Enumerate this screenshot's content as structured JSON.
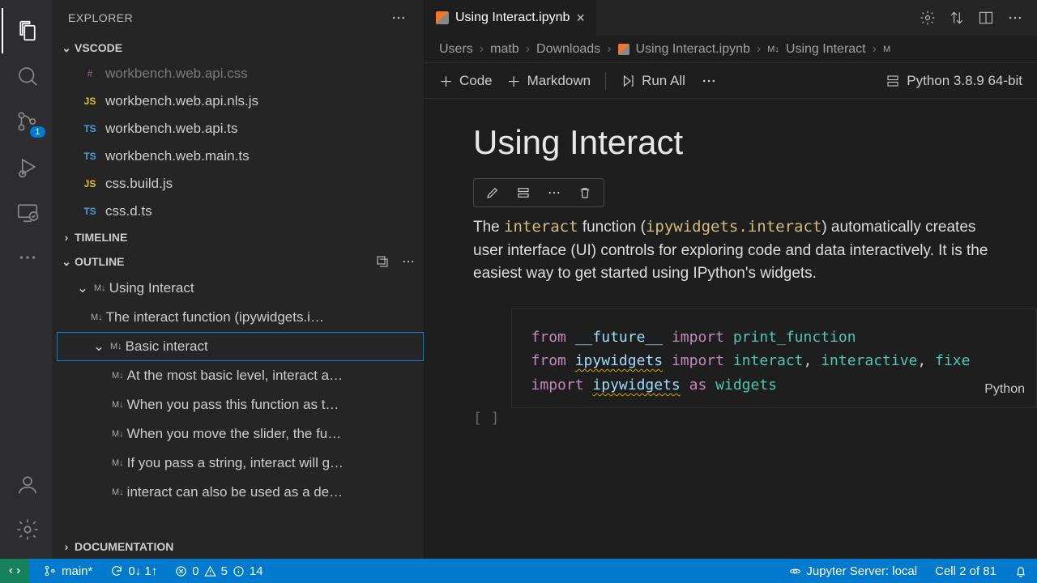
{
  "sidebar": {
    "title": "EXPLORER",
    "sections": {
      "vscode": "VSCODE",
      "timeline": "TIMELINE",
      "outline": "OUTLINE",
      "documentation": "DOCUMENTATION"
    },
    "files": [
      {
        "icon": "#",
        "lang": "hash",
        "name": "workbench.web.api.css"
      },
      {
        "icon": "JS",
        "lang": "js",
        "name": "workbench.web.api.nls.js"
      },
      {
        "icon": "TS",
        "lang": "ts",
        "name": "workbench.web.api.ts"
      },
      {
        "icon": "TS",
        "lang": "ts",
        "name": "workbench.web.main.ts"
      },
      {
        "icon": "JS",
        "lang": "js",
        "name": "css.build.js"
      },
      {
        "icon": "TS",
        "lang": "ts",
        "name": "css.d.ts"
      }
    ],
    "outline": [
      {
        "level": 1,
        "chev": true,
        "label": "Using Interact"
      },
      {
        "level": 2,
        "chev": false,
        "label": "The interact function (ipywidgets.i…"
      },
      {
        "level": 2,
        "chev": true,
        "label": "Basic interact",
        "selected": true
      },
      {
        "level": 3,
        "chev": false,
        "label": "At the most basic level, interact a…"
      },
      {
        "level": 3,
        "chev": false,
        "label": "When you pass this function as t…"
      },
      {
        "level": 3,
        "chev": false,
        "label": "When you move the slider, the fu…"
      },
      {
        "level": 3,
        "chev": false,
        "label": "If you pass a string, interact will g…"
      },
      {
        "level": 3,
        "chev": false,
        "label": "interact can also be used as a de…"
      }
    ],
    "scm_badge": "1"
  },
  "editor": {
    "tab_title": "Using Interact.ipynb",
    "breadcrumb": [
      "Users",
      "matb",
      "Downloads",
      "Using Interact.ipynb",
      "Using Interact"
    ],
    "toolbar": {
      "code": "Code",
      "markdown": "Markdown",
      "runall": "Run All",
      "kernel": "Python 3.8.9 64-bit"
    },
    "notebook_title": "Using Interact",
    "text_parts": {
      "p1": "The ",
      "code1": "interact",
      "p2": " function (",
      "code2": "ipywidgets.interact",
      "p3": ") automatically creates user interface (UI) controls for exploring code and data interactively. It is the easiest way to get started using IPython's widgets."
    },
    "code_lang_label": "Python",
    "exec_marker": "[ ]"
  },
  "status": {
    "branch": "main*",
    "sync": "0↓ 1↑",
    "errors": "0",
    "warnings": "5",
    "info": "14",
    "jupyter": "Jupyter Server: local",
    "cell": "Cell 2 of 81"
  }
}
